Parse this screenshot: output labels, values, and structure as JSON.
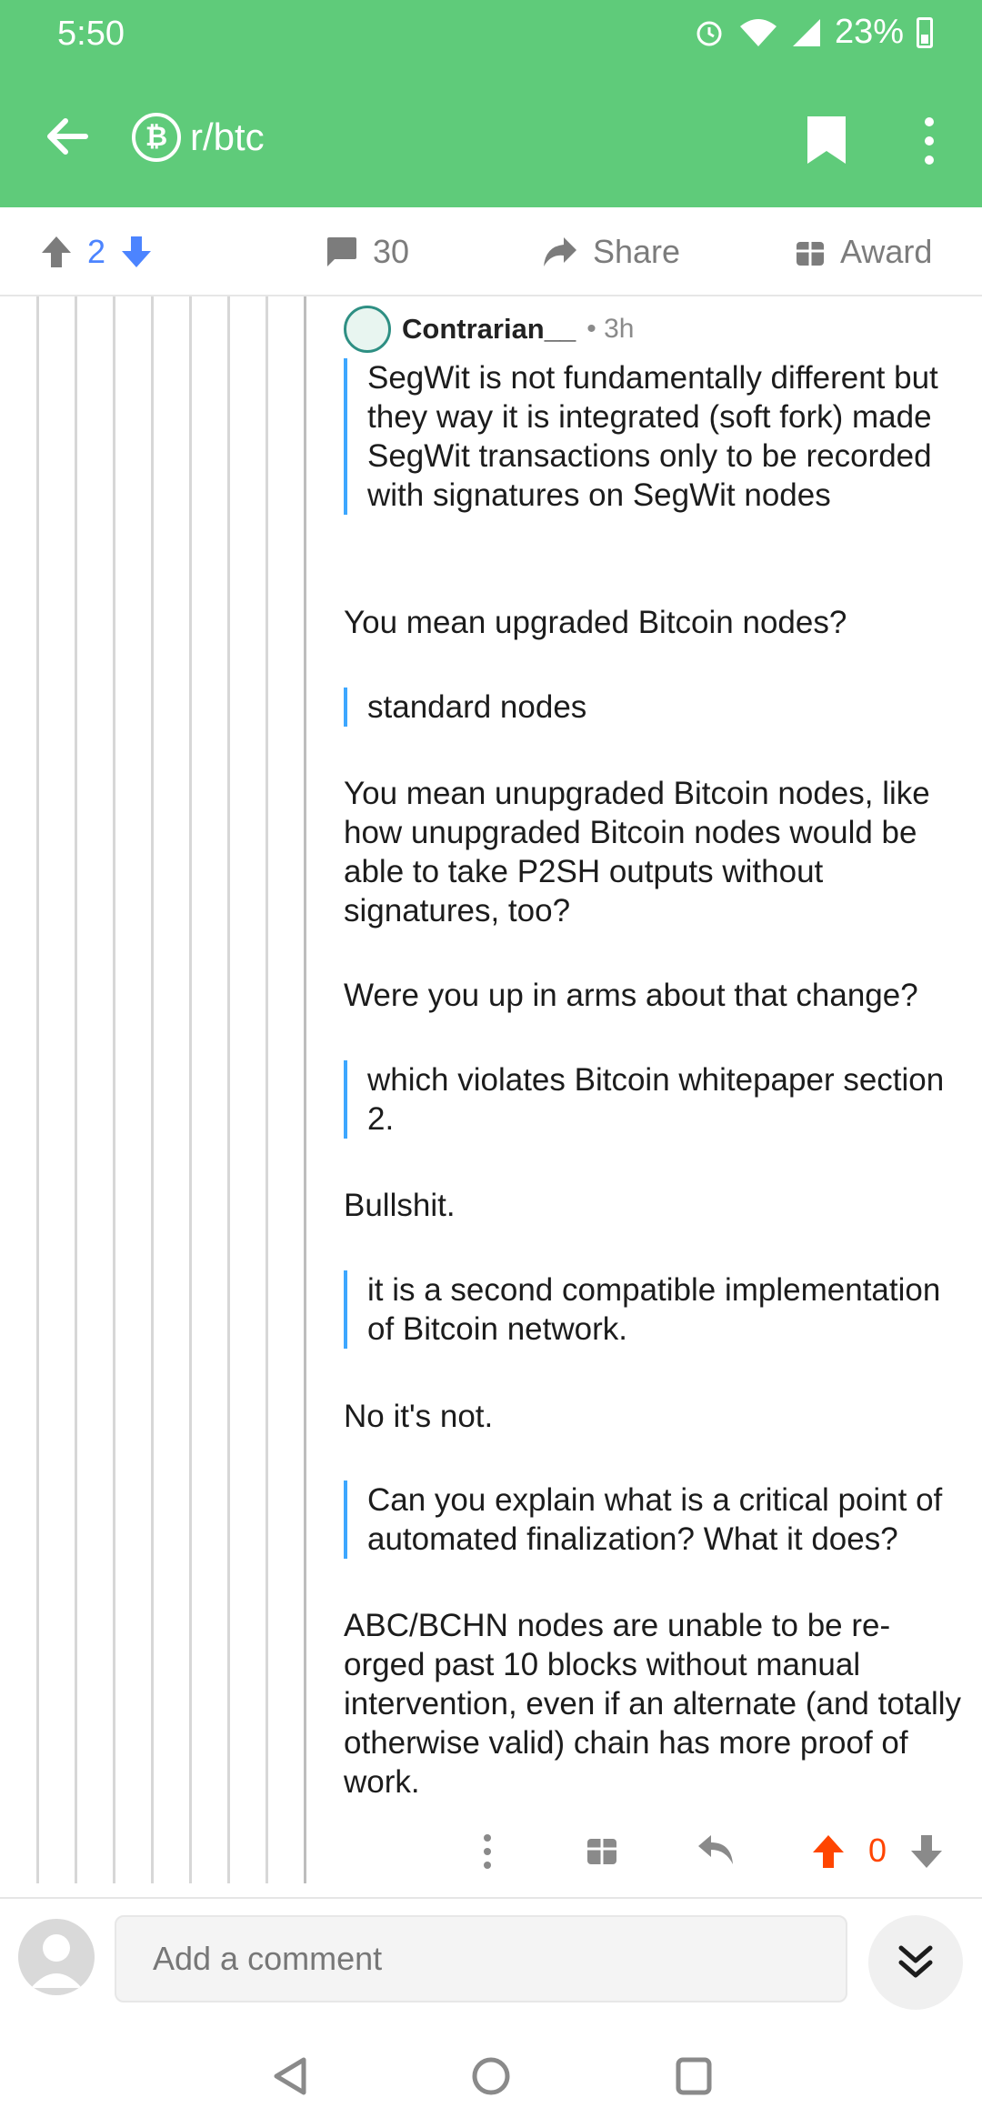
{
  "status": {
    "time": "5:50",
    "battery": "23%"
  },
  "header": {
    "subreddit": "r/btc"
  },
  "actions": {
    "votes": "2",
    "comments": "30",
    "share": "Share",
    "award": "Award"
  },
  "comment": {
    "author": "Contrarian__",
    "time": "• 3h",
    "blocks": [
      {
        "type": "quote",
        "text": "SegWit is not fundamentally different but they way it is integrated (soft fork) made SegWit transactions only to be recorded with signatures on SegWit nodes"
      },
      {
        "type": "text",
        "text": "You mean upgraded Bitcoin nodes?"
      },
      {
        "type": "quote",
        "text": "standard nodes"
      },
      {
        "type": "text",
        "text": "You mean unupgraded Bitcoin nodes, like how unupgraded Bitcoin nodes would be able to take P2SH outputs without signatures, too?"
      },
      {
        "type": "text",
        "text": "Were you up in arms about that change?"
      },
      {
        "type": "quote",
        "text": "which violates Bitcoin whitepaper section 2."
      },
      {
        "type": "text",
        "text": "Bullshit."
      },
      {
        "type": "quote",
        "text": "it is a second compatible implementation of Bitcoin network."
      },
      {
        "type": "text",
        "text": "No it's not."
      },
      {
        "type": "quote",
        "text": "Can you explain what is a critical point of automated finalization? What it does?"
      },
      {
        "type": "text",
        "text": "ABC/BCHN nodes are unable to be re-orged past 10 blocks without manual intervention, even if an alternate (and totally otherwise valid) chain has more proof of work."
      }
    ],
    "score": "0"
  },
  "comment_bar": {
    "placeholder": "Add a comment"
  },
  "colors": {
    "header": "#5fcb7a",
    "upvote": "#ff4500",
    "vote_blue": "#4c84ff",
    "quote_bar": "#3da7ff"
  }
}
